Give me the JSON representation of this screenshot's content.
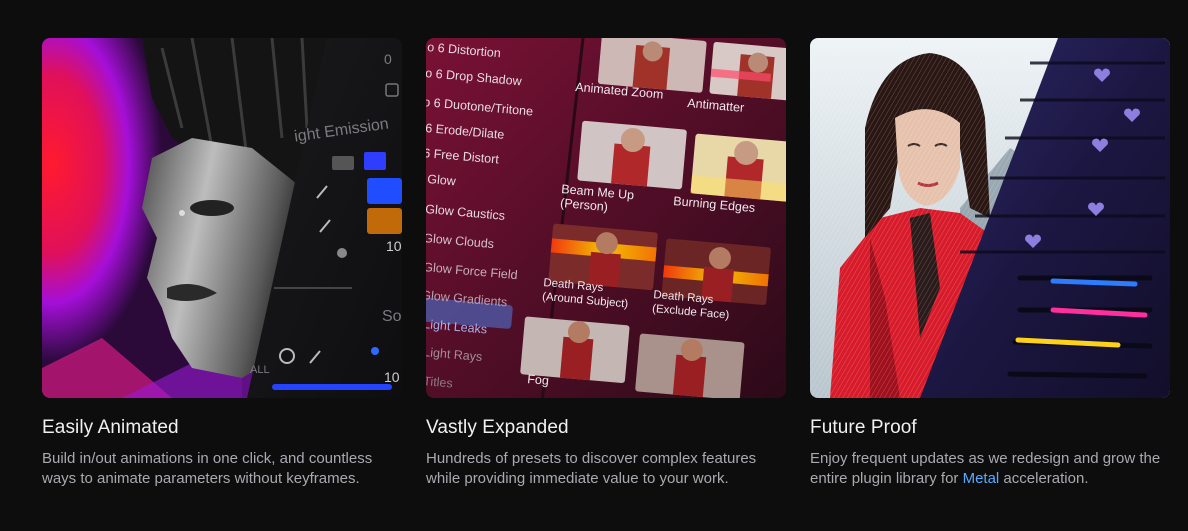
{
  "cards": [
    {
      "title": "Easily Animated",
      "description": "Build in/out animations in one click, and countless ways to animate parameters without keyframes.",
      "image": {
        "subject": "portrait",
        "panel_texts": {
          "value_top": "0",
          "section": "ight Emission",
          "value_mid": "10",
          "section_2": "So",
          "tab_all": "ALL",
          "value_bottom": "10"
        }
      }
    },
    {
      "title": "Vastly Expanded",
      "description": "Hundreds of presets to discover complex features while providing immediate value to your work.",
      "image": {
        "effects_list": [
          "o 6 Distortion",
          "o 6 Drop Shadow",
          "o 6 Duotone/Tritone",
          "6 Erode/Dilate",
          "6 Free Distort",
          "Glow",
          "Glow Caustics",
          "Glow Clouds",
          "Glow Force Field",
          "Glow Gradients",
          "Light Leaks",
          "Light Rays",
          "Titles"
        ],
        "presets": [
          "Animated Zoom",
          "Antimatter",
          "Beam Me Up (Person)",
          "Burning Edges",
          "Death Rays (Around Subject)",
          "Death Rays (Exclude Face)",
          "Fog"
        ]
      }
    },
    {
      "title": "Future Proof",
      "description_before": "Enjoy frequent updates as we redesign and grow the entire plugin library for ",
      "description_link": "Metal",
      "description_after": " acceleration.",
      "image": {
        "subject": "portrait in red jacket",
        "slider_colors": [
          "#2d7cff",
          "#ff2fa0",
          "#ffd21a"
        ]
      }
    }
  ],
  "colors": {
    "background": "#0d0d0e",
    "title": "#f0f0f2",
    "description": "#a9a9b0",
    "link": "#5aa9ff"
  }
}
